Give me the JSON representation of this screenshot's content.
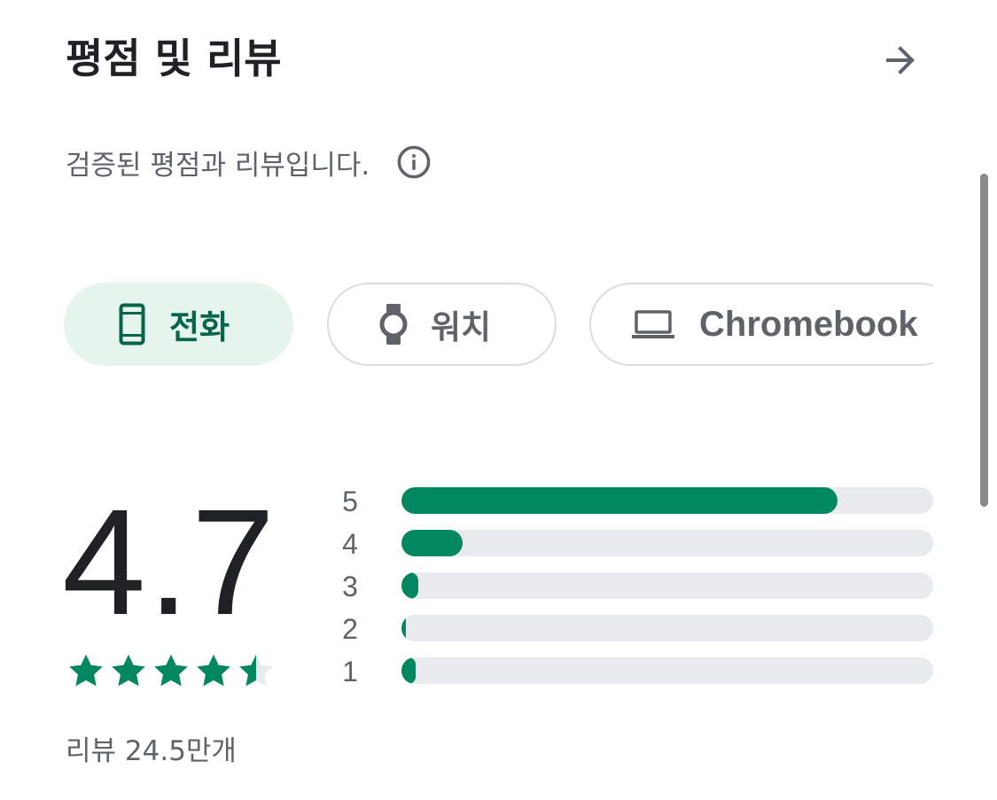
{
  "header": {
    "title": "평점 및 리뷰",
    "arrow_icon": "arrow-forward-icon"
  },
  "subtitle": {
    "text": "검증된 평점과 리뷰입니다.",
    "info_icon": "info-icon"
  },
  "device_chips": [
    {
      "label": "전화",
      "icon": "phone-icon",
      "selected": true
    },
    {
      "label": "워치",
      "icon": "watch-icon",
      "selected": false
    },
    {
      "label": "Chromebook",
      "icon": "laptop-icon",
      "selected": false
    }
  ],
  "rating": {
    "score": "4.7",
    "stars": 4.7,
    "review_count": "리뷰 24.5만개"
  },
  "histogram": [
    {
      "label": "5",
      "fraction": 0.82
    },
    {
      "label": "4",
      "fraction": 0.115
    },
    {
      "label": "3",
      "fraction": 0.032
    },
    {
      "label": "2",
      "fraction": 0.008
    },
    {
      "label": "1",
      "fraction": 0.027
    }
  ],
  "colors": {
    "accent": "#01875f",
    "chip_selected_bg": "#e6f4ee",
    "chip_selected_text": "#056449",
    "track": "#e8eaed",
    "secondary_text": "#5f6368"
  }
}
